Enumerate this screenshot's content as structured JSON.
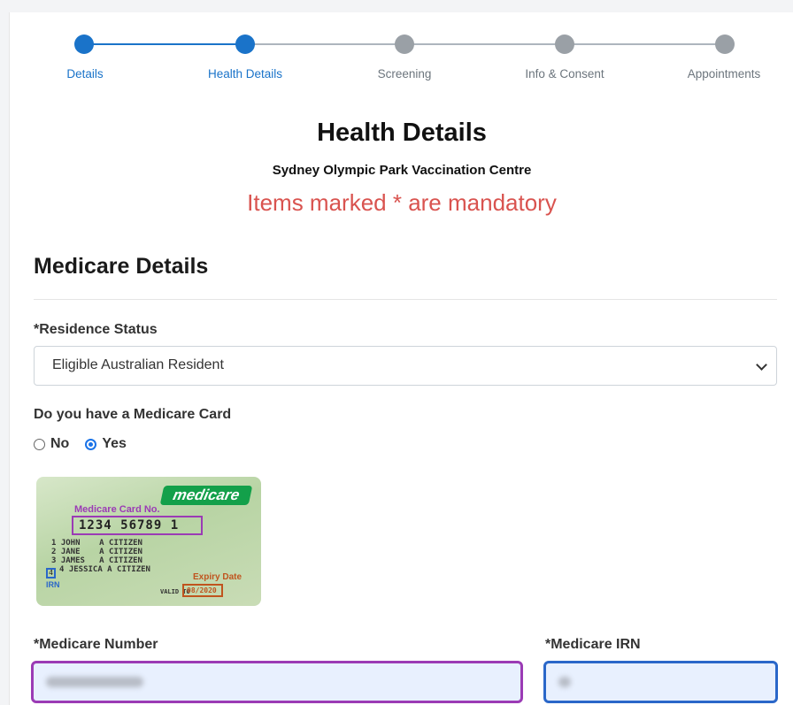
{
  "stepper": {
    "steps": [
      {
        "label": "Details",
        "status": "done"
      },
      {
        "label": "Health Details",
        "status": "current"
      },
      {
        "label": "Screening",
        "status": "todo"
      },
      {
        "label": "Info & Consent",
        "status": "todo"
      },
      {
        "label": "Appointments",
        "status": "todo"
      }
    ],
    "active_color": "#1a73c9",
    "inactive_color": "#9aa0a6"
  },
  "header": {
    "title": "Health Details",
    "centre": "Sydney Olympic Park Vaccination Centre",
    "mandatory_note": "Items marked * are mandatory"
  },
  "medicare": {
    "section_title": "Medicare Details",
    "residence_status": {
      "label": "*Residence Status",
      "selected": "Eligible Australian Resident"
    },
    "has_card": {
      "question": "Do you have a Medicare Card",
      "options": [
        {
          "label": "No",
          "checked": false
        },
        {
          "label": "Yes",
          "checked": true
        }
      ]
    },
    "card_image": {
      "logo": "medicare",
      "number_caption": "Medicare Card No.",
      "number": "1234 56789 1",
      "names": [
        "1 JOHN    A CITIZEN",
        "2 JANE    A CITIZEN",
        "3 JAMES   A CITIZEN",
        "4 JESSICA A CITIZEN"
      ],
      "irn_caption": "IRN",
      "irn_value": "4",
      "expiry_caption": "Expiry Date",
      "valid_to": "VALID TO",
      "expiry": "08/2020"
    },
    "number_field": {
      "label": "*Medicare Number",
      "value": ""
    },
    "irn_field": {
      "label": "*Medicare IRN",
      "value": ""
    }
  },
  "colors": {
    "mandatory_text": "#d9534f",
    "number_field_border": "#9b3bb5",
    "irn_field_border": "#2a67c9"
  }
}
